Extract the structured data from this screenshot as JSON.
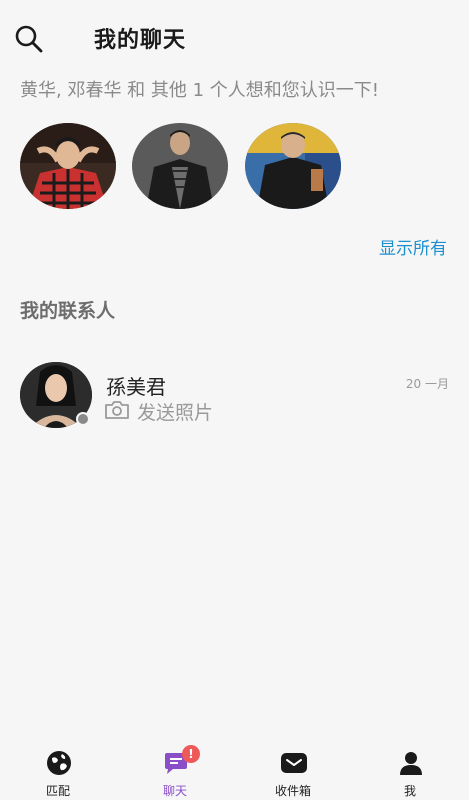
{
  "header": {
    "title": "我的聊天",
    "search_icon": "search-icon"
  },
  "suggestions": {
    "text": "黄华, 邓春华 和 其他 1 个人想和您认识一下!",
    "people": [
      {
        "icon": "person-photo-plaid-shirt"
      },
      {
        "icon": "person-photo-black-jacket"
      },
      {
        "icon": "person-photo-black-hoodie"
      }
    ],
    "show_all": "显示所有"
  },
  "contacts": {
    "section_title": "我的联系人",
    "items": [
      {
        "name": "孫美君",
        "date": "20 一月",
        "subtitle": "发送照片",
        "subtitle_icon": "camera-icon",
        "status": "offline"
      }
    ]
  },
  "bottom_nav": {
    "items": [
      {
        "label": "匹配",
        "icon": "globe-icon"
      },
      {
        "label": "聊天",
        "icon": "chat-icon",
        "badge": "!",
        "active": true
      },
      {
        "label": "收件箱",
        "icon": "mail-icon"
      },
      {
        "label": "我",
        "icon": "person-icon"
      }
    ]
  },
  "colors": {
    "background": "#f6f6f6",
    "link": "#1d8fd0",
    "active_tab": "#8a4ec9",
    "badge": "#ee5a5a"
  }
}
